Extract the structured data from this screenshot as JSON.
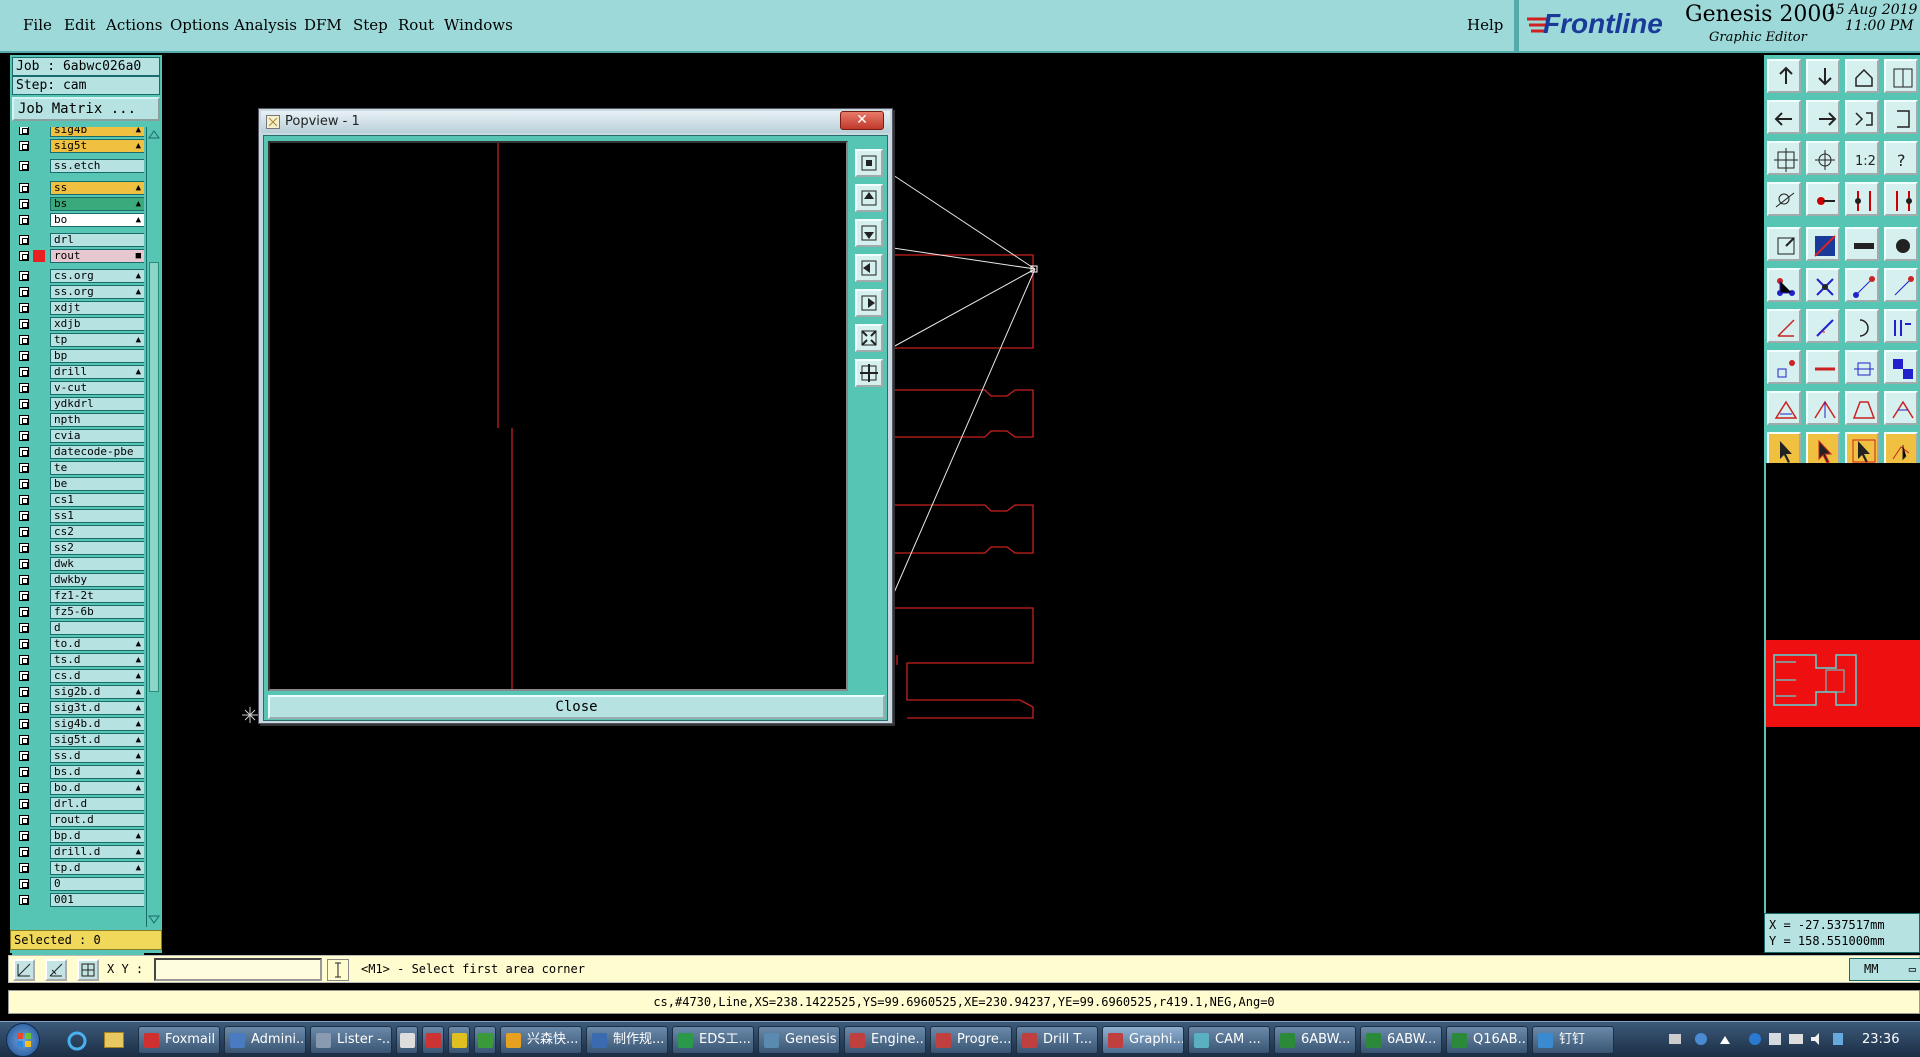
{
  "menu": [
    {
      "label": "File"
    },
    {
      "label": "Edit"
    },
    {
      "label": "Actions"
    },
    {
      "label": "Options"
    },
    {
      "label": "Analysis"
    },
    {
      "label": "DFM"
    },
    {
      "label": "Step"
    },
    {
      "label": "Rout"
    },
    {
      "label": "Windows"
    }
  ],
  "help_label": "Help",
  "brand": {
    "logo": "Frontline",
    "product": "Genesis 2000",
    "subtitle": "Graphic Editor",
    "date": "15 Aug 2019",
    "time": "11:00 PM"
  },
  "job": {
    "job_line": "Job : 6abwc026a0",
    "step_line": "Step: cam",
    "matrix_button": "Job Matrix ..."
  },
  "layers": [
    {
      "name": "sig4b",
      "color": "#f0c040",
      "icon": "▲"
    },
    {
      "name": "sig5t",
      "color": "#f0c040",
      "icon": "▲"
    },
    {
      "name": "ss.etch",
      "color": "",
      "icon": ""
    },
    {
      "name": "ss",
      "color": "#f0c040",
      "icon": "▲"
    },
    {
      "name": "bs",
      "color": "#3aaa7a",
      "icon": "▲"
    },
    {
      "name": "bo",
      "color": "#ffffff",
      "icon": "▲"
    },
    {
      "name": "drl",
      "color": "",
      "icon": ""
    },
    {
      "name": "rout",
      "color": "#e8c8d0",
      "icon": "■"
    },
    {
      "name": "cs.org",
      "color": "",
      "icon": "▲"
    },
    {
      "name": "ss.org",
      "color": "",
      "icon": "▲"
    },
    {
      "name": "xdjt",
      "color": "",
      "icon": ""
    },
    {
      "name": "xdjb",
      "color": "",
      "icon": ""
    },
    {
      "name": "tp",
      "color": "",
      "icon": "▲"
    },
    {
      "name": "bp",
      "color": "",
      "icon": ""
    },
    {
      "name": "drill",
      "color": "",
      "icon": "▲"
    },
    {
      "name": "v-cut",
      "color": "",
      "icon": ""
    },
    {
      "name": "ydkdrl",
      "color": "",
      "icon": ""
    },
    {
      "name": "npth",
      "color": "",
      "icon": ""
    },
    {
      "name": "cvia",
      "color": "",
      "icon": ""
    },
    {
      "name": "datecode-pbe",
      "color": "",
      "icon": ""
    },
    {
      "name": "te",
      "color": "",
      "icon": ""
    },
    {
      "name": "be",
      "color": "",
      "icon": ""
    },
    {
      "name": "cs1",
      "color": "",
      "icon": ""
    },
    {
      "name": "ss1",
      "color": "",
      "icon": ""
    },
    {
      "name": "cs2",
      "color": "",
      "icon": ""
    },
    {
      "name": "ss2",
      "color": "",
      "icon": ""
    },
    {
      "name": "dwk",
      "color": "",
      "icon": ""
    },
    {
      "name": "dwkby",
      "color": "",
      "icon": ""
    },
    {
      "name": "fz1-2t",
      "color": "",
      "icon": ""
    },
    {
      "name": "fz5-6b",
      "color": "",
      "icon": ""
    },
    {
      "name": "d",
      "color": "",
      "icon": ""
    },
    {
      "name": "to.d",
      "color": "",
      "icon": "▲"
    },
    {
      "name": "ts.d",
      "color": "",
      "icon": "▲"
    },
    {
      "name": "cs.d",
      "color": "",
      "icon": "▲"
    },
    {
      "name": "sig2b.d",
      "color": "",
      "icon": "▲"
    },
    {
      "name": "sig3t.d",
      "color": "",
      "icon": "▲"
    },
    {
      "name": "sig4b.d",
      "color": "",
      "icon": "▲"
    },
    {
      "name": "sig5t.d",
      "color": "",
      "icon": "▲"
    },
    {
      "name": "ss.d",
      "color": "",
      "icon": "▲"
    },
    {
      "name": "bs.d",
      "color": "",
      "icon": "▲"
    },
    {
      "name": "bo.d",
      "color": "",
      "icon": "▲"
    },
    {
      "name": "drl.d",
      "color": "",
      "icon": ""
    },
    {
      "name": "rout.d",
      "color": "",
      "icon": ""
    },
    {
      "name": "bp.d",
      "color": "",
      "icon": "▲"
    },
    {
      "name": "drill.d",
      "color": "",
      "icon": "▲"
    },
    {
      "name": "tp.d",
      "color": "",
      "icon": "▲"
    },
    {
      "name": "0",
      "color": "",
      "icon": ""
    },
    {
      "name": "001",
      "color": "",
      "icon": ""
    }
  ],
  "selected": "Selected : 0",
  "popview": {
    "title": "Popview - 1",
    "close_label": "Close"
  },
  "coords": {
    "x": "X = -27.537517mm",
    "y": "Y = 158.551000mm"
  },
  "cmd": {
    "xy_label": "X Y :",
    "xy_value": "",
    "prompt": "<M1> - Select first area corner",
    "units": "MM"
  },
  "status": "cs,#4730,Line,XS=238.1422525,YS=99.6960525,XE=230.94237,YE=99.6960525,r419.1,NEG,Ang=0",
  "taskbar": {
    "items": [
      {
        "label": "Foxmail",
        "icon_color": "#d03030"
      },
      {
        "label": "Admini...",
        "icon_color": "#4a7ac0"
      },
      {
        "label": "Lister -...",
        "icon_color": "#8a9ab0"
      },
      {
        "label": "",
        "icon_color": "#ddd"
      },
      {
        "label": "",
        "icon_color": "#c33"
      },
      {
        "label": "",
        "icon_color": "#e0c020"
      },
      {
        "label": "",
        "icon_color": "#3a9a3a"
      },
      {
        "label": "兴森快...",
        "icon_color": "#e8a020"
      },
      {
        "label": "制作规...",
        "icon_color": "#3a6ab0"
      },
      {
        "label": "EDS工...",
        "icon_color": "#2a9a4a"
      },
      {
        "label": "Genesis",
        "icon_color": "#5a8ab0"
      },
      {
        "label": "Engine...",
        "icon_color": "#c04040"
      },
      {
        "label": "Progre...",
        "icon_color": "#c04040"
      },
      {
        "label": "Drill T...",
        "icon_color": "#c04040"
      },
      {
        "label": "Graphi...",
        "icon_color": "#c04040"
      },
      {
        "label": "CAM ...",
        "icon_color": "#5ab0c0"
      },
      {
        "label": "6ABW...",
        "icon_color": "#2a8a3a"
      },
      {
        "label": "6ABW...",
        "icon_color": "#2a8a3a"
      },
      {
        "label": "Q16AB...",
        "icon_color": "#2a8a3a"
      },
      {
        "label": "钉钉",
        "icon_color": "#3a8ad0"
      }
    ],
    "clock": "23:36"
  }
}
